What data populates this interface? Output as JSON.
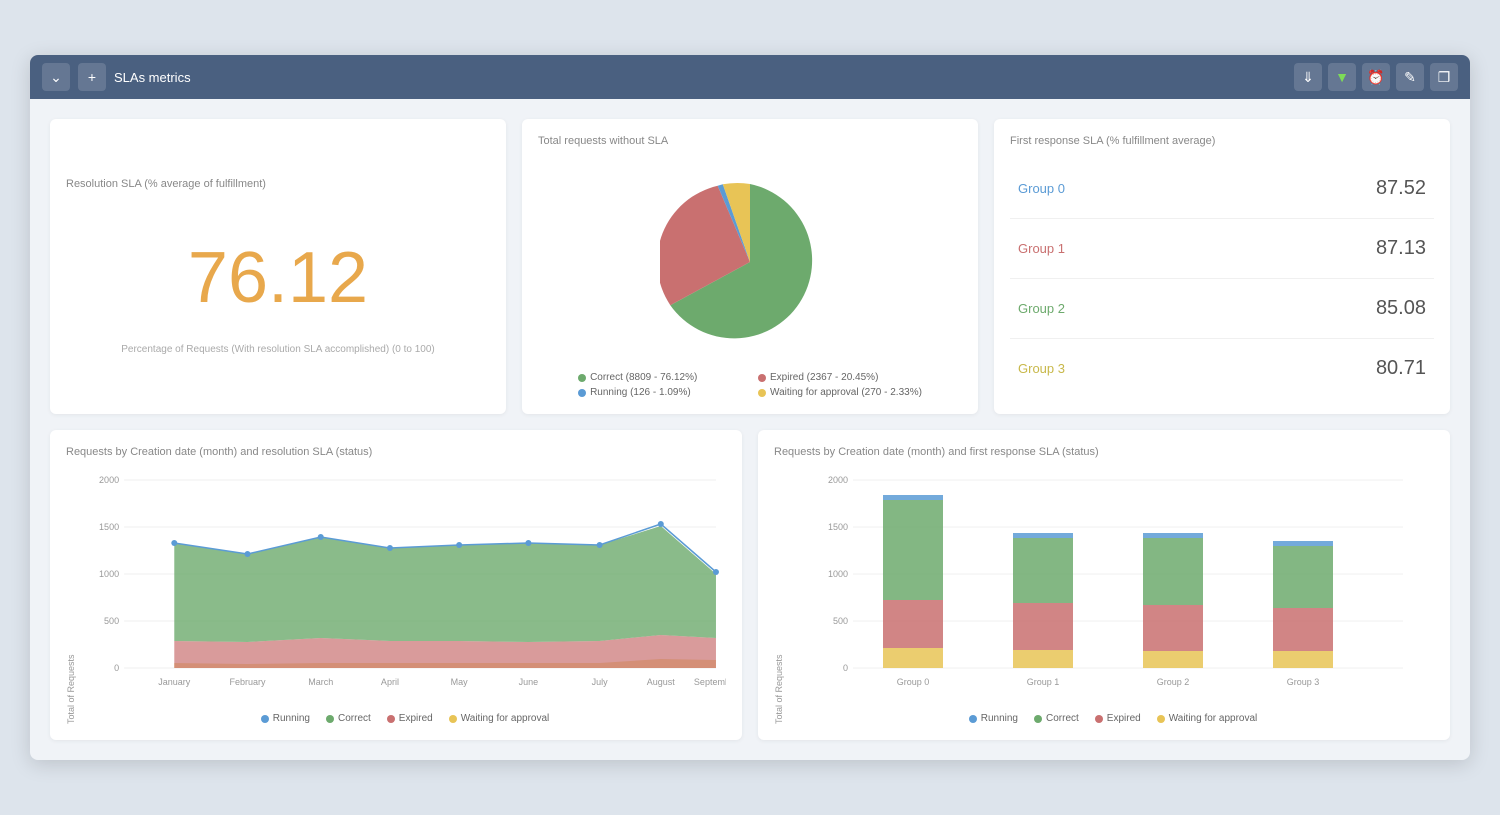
{
  "titlebar": {
    "title": "SLAs metrics",
    "buttons": [
      "chevron-down",
      "plus"
    ]
  },
  "cards": {
    "resolution_sla": {
      "title": "Resolution SLA (% average of fulfillment)",
      "value": "76.12",
      "subtitle": "Percentage of Requests (With resolution SLA accomplished) (0 to 100)"
    },
    "total_requests": {
      "title": "Total requests without SLA",
      "segments": [
        {
          "label": "Correct",
          "value": 8809,
          "pct": 76.12,
          "color": "#6daa6d"
        },
        {
          "label": "Expired",
          "value": 2367,
          "pct": 20.45,
          "color": "#c97070"
        },
        {
          "label": "Running",
          "value": 126,
          "pct": 1.09,
          "color": "#5b9bd5"
        },
        {
          "label": "Waiting for approval",
          "value": 270,
          "pct": 2.33,
          "color": "#e8c456"
        }
      ]
    },
    "first_response_sla": {
      "title": "First response SLA (% fulfillment average)",
      "groups": [
        {
          "name": "Group 0",
          "value": "87.52",
          "color": "#5b9bd5"
        },
        {
          "name": "Group 1",
          "value": "87.13",
          "color": "#c97070"
        },
        {
          "name": "Group 2",
          "value": "85.08",
          "color": "#6daa6d"
        },
        {
          "name": "Group 3",
          "value": "80.71",
          "color": "#c8b84a"
        }
      ]
    },
    "resolution_by_month": {
      "title": "Requests by Creation date (month) and resolution SLA (status)",
      "y_label": "Total of Requests",
      "months": [
        "January",
        "February",
        "March",
        "April",
        "May",
        "June",
        "July",
        "August",
        "September"
      ],
      "legend": [
        "Running",
        "Correct",
        "Expired",
        "Waiting for approval"
      ]
    },
    "first_response_by_group": {
      "title": "Requests by Creation date (month) and first response SLA (status)",
      "y_label": "Total of Requests",
      "groups_x": [
        "Group 0",
        "Group 1",
        "Group 2",
        "Group 3"
      ],
      "legend": [
        "Running",
        "Correct",
        "Expired",
        "Waiting for approval"
      ]
    }
  },
  "colors": {
    "correct": "#6daa6d",
    "expired": "#c97070",
    "running": "#5b9bd5",
    "waiting": "#e8c456",
    "orange": "#e8a84c",
    "titlebar_bg": "#4a6080"
  }
}
